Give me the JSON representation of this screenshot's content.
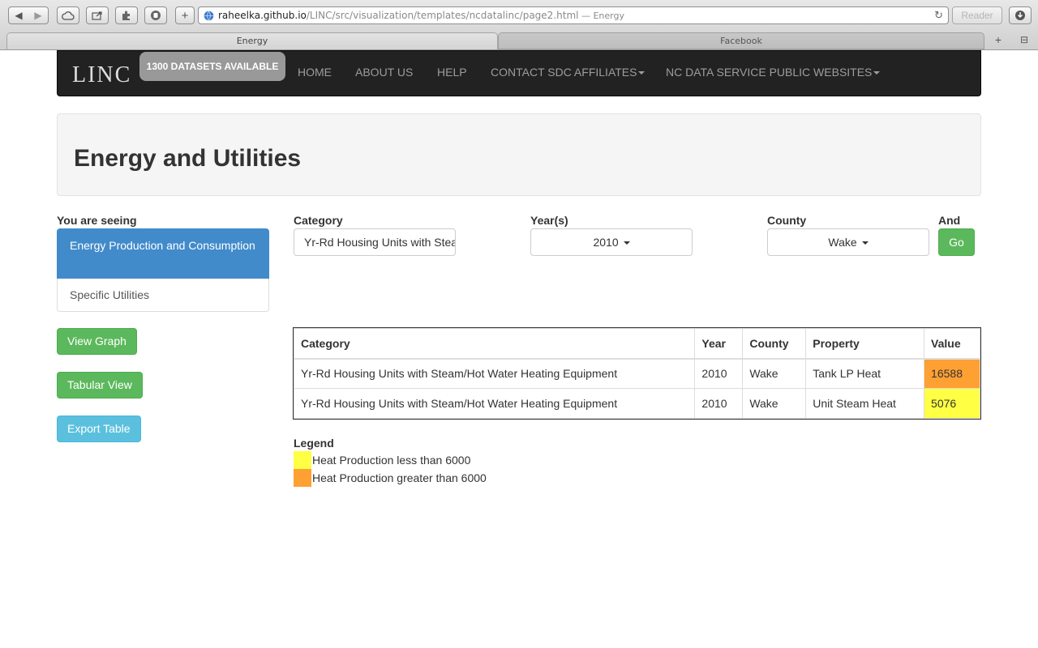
{
  "browser": {
    "url_host": "raheelka.github.io",
    "url_path": "/LINC/src/visualization/templates/ncdatalinc/page2.html",
    "url_title_suffix": " — Energy",
    "reader_label": "Reader",
    "tabs": [
      {
        "label": "Energy",
        "active": true
      },
      {
        "label": "Facebook",
        "active": false
      }
    ]
  },
  "navbar": {
    "brand": "LINC",
    "badge": "1300 DATASETS AVAILABLE",
    "items": [
      {
        "label": "HOME"
      },
      {
        "label": "ABOUT US"
      },
      {
        "label": "HELP"
      },
      {
        "label": "CONTACT SDC AFFILIATES"
      },
      {
        "label": "NC DATA SERVICE PUBLIC WEBSITES"
      }
    ]
  },
  "page": {
    "title": "Energy and Utilities"
  },
  "sidebar": {
    "heading": "You are seeing",
    "items": [
      {
        "label": "Energy Production and Consumption",
        "active": true
      },
      {
        "label": "Specific Utilities",
        "active": false
      }
    ],
    "buttons": {
      "view_graph": "View Graph",
      "tabular_view": "Tabular View",
      "export_table": "Export Table"
    }
  },
  "filters": {
    "category_label": "Category",
    "category_value": "Yr-Rd Housing Units with Steam/Hot Water Heating Equipment",
    "year_label": "Year(s)",
    "year_value": "2010",
    "county_label": "County",
    "county_value": "Wake",
    "and_label": "And",
    "go_label": "Go"
  },
  "table": {
    "headers": [
      "Category",
      "Year",
      "County",
      "Property",
      "Value"
    ],
    "rows": [
      {
        "category": "Yr-Rd Housing Units with Steam/Hot Water Heating Equipment",
        "year": "2010",
        "county": "Wake",
        "property": "Tank LP Heat",
        "value": "16588",
        "level": "high"
      },
      {
        "category": "Yr-Rd Housing Units with Steam/Hot Water Heating Equipment",
        "year": "2010",
        "county": "Wake",
        "property": "Unit Steam Heat",
        "value": "5076",
        "level": "low"
      }
    ]
  },
  "legend": {
    "title": "Legend",
    "items": [
      {
        "label": "Heat Production less than 6000",
        "color": "#ffff44"
      },
      {
        "label": "Heat Production greater than 6000",
        "color": "#ffa033"
      }
    ]
  },
  "colors": {
    "navbar_bg": "#222222",
    "active_item": "#428bca",
    "success": "#5cb85c",
    "info": "#5bc0de",
    "high_value": "#ffa033",
    "low_value": "#ffff44"
  }
}
